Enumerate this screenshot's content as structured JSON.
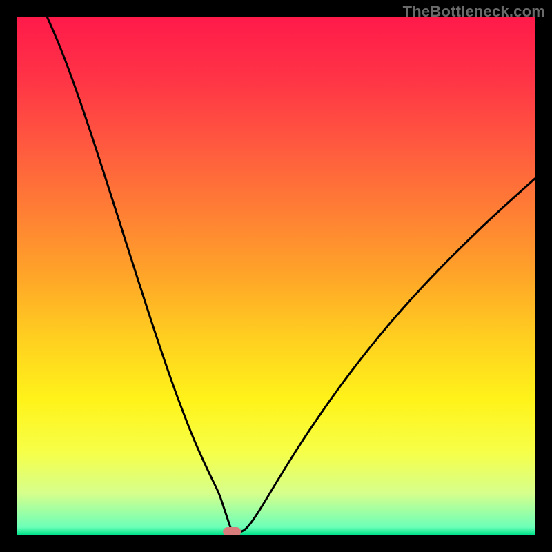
{
  "watermark": "TheBottleneck.com",
  "gradient_stops": [
    {
      "offset": 0.0,
      "color": "#ff1a4a"
    },
    {
      "offset": 0.12,
      "color": "#ff3446"
    },
    {
      "offset": 0.25,
      "color": "#ff5a3f"
    },
    {
      "offset": 0.38,
      "color": "#ff8034"
    },
    {
      "offset": 0.5,
      "color": "#ffa528"
    },
    {
      "offset": 0.62,
      "color": "#ffcf20"
    },
    {
      "offset": 0.74,
      "color": "#fff31a"
    },
    {
      "offset": 0.84,
      "color": "#f6ff48"
    },
    {
      "offset": 0.92,
      "color": "#d6ff8c"
    },
    {
      "offset": 0.985,
      "color": "#6dffb8"
    },
    {
      "offset": 1.0,
      "color": "#00e38a"
    }
  ],
  "marker": {
    "x_frac": 0.415,
    "y_frac": 0.994,
    "w_frac": 0.035,
    "h_frac": 0.0175,
    "rx_frac": 0.009,
    "fill": "#d97c7c"
  },
  "chart_data": {
    "type": "line",
    "title": "",
    "xlabel": "",
    "ylabel": "",
    "xlim": [
      0,
      100
    ],
    "ylim": [
      0,
      100
    ],
    "grid": false,
    "legend": false,
    "notes": "V-shaped bottleneck curve. Axes and ticks are not labeled in the image; values are read as percentages of the plot area (0 at bottom/left, 100 at top/right).",
    "series": [
      {
        "name": "curve",
        "color": "#000000",
        "x": [
          5.8,
          8,
          10,
          12,
          14,
          16,
          18,
          20,
          22,
          24,
          26,
          28,
          30,
          32,
          34,
          36,
          38,
          39,
          40,
          41,
          41.5,
          43.5,
          45,
          47,
          50,
          54,
          58,
          62,
          66,
          70,
          74,
          78,
          82,
          86,
          90,
          94,
          98,
          100
        ],
        "y": [
          100,
          95,
          89.8,
          84.2,
          78.3,
          72.2,
          66,
          59.7,
          53.4,
          47.2,
          41,
          35,
          29.2,
          23.8,
          18.7,
          14.2,
          10,
          8,
          5,
          2,
          0.5,
          0.5,
          2,
          5,
          10,
          16.5,
          22.5,
          28.2,
          33.5,
          38.5,
          43.2,
          47.6,
          51.8,
          55.8,
          59.7,
          63.4,
          67,
          68.8
        ]
      }
    ]
  }
}
